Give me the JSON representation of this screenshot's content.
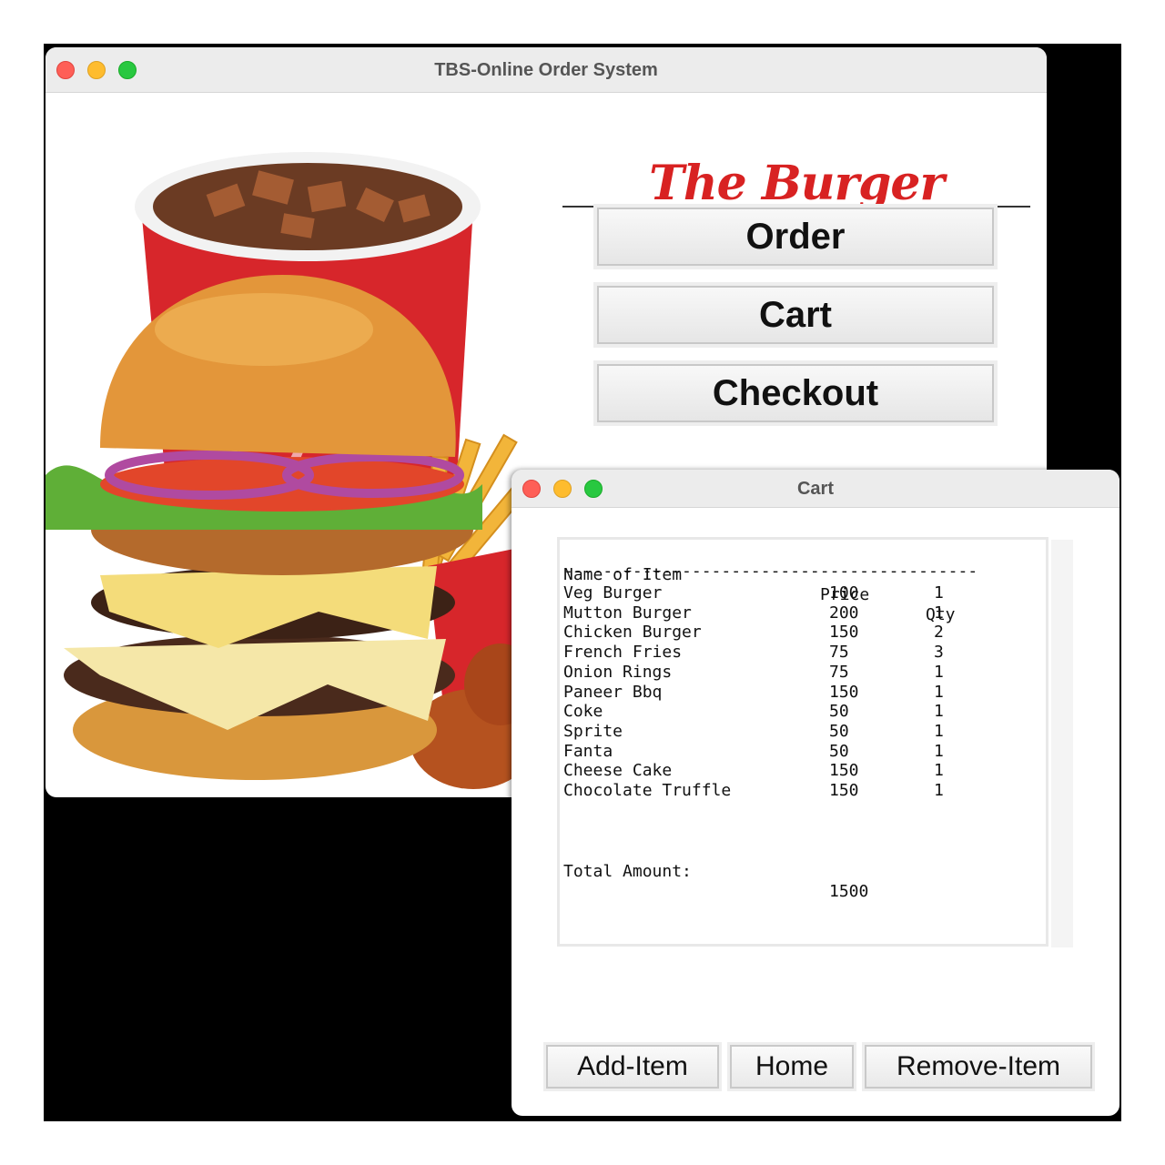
{
  "main_window": {
    "title": "TBS-Online Order System",
    "brand": "The Burger Surfer",
    "buttons": {
      "order": "Order",
      "cart": "Cart",
      "checkout": "Checkout"
    }
  },
  "cart_window": {
    "title": "Cart",
    "headers": {
      "name": "Name of Item",
      "price": "Price",
      "qty": "Qty"
    },
    "separator": "------------------------------------------",
    "items": [
      {
        "name": "Veg Burger",
        "price": "100",
        "qty": "1"
      },
      {
        "name": "Mutton Burger",
        "price": "200",
        "qty": "1"
      },
      {
        "name": "Chicken Burger",
        "price": "150",
        "qty": "2"
      },
      {
        "name": "French Fries",
        "price": "75",
        "qty": "3"
      },
      {
        "name": "Onion Rings",
        "price": "75",
        "qty": "1"
      },
      {
        "name": "Paneer Bbq",
        "price": "150",
        "qty": "1"
      },
      {
        "name": "Coke",
        "price": "50",
        "qty": "1"
      },
      {
        "name": "Sprite",
        "price": "50",
        "qty": "1"
      },
      {
        "name": "Fanta",
        "price": "50",
        "qty": "1"
      },
      {
        "name": "Cheese Cake",
        "price": "150",
        "qty": "1"
      },
      {
        "name": "Chocolate Truffle",
        "price": "150",
        "qty": "1"
      }
    ],
    "total_label": "Total Amount:",
    "total_value": "1500",
    "buttons": {
      "add": "Add-Item",
      "home": "Home",
      "remove": "Remove-Item"
    }
  },
  "colors": {
    "brand_red": "#d82222",
    "close": "#fe5f57",
    "minimize": "#febc2e",
    "zoom": "#28c840"
  }
}
